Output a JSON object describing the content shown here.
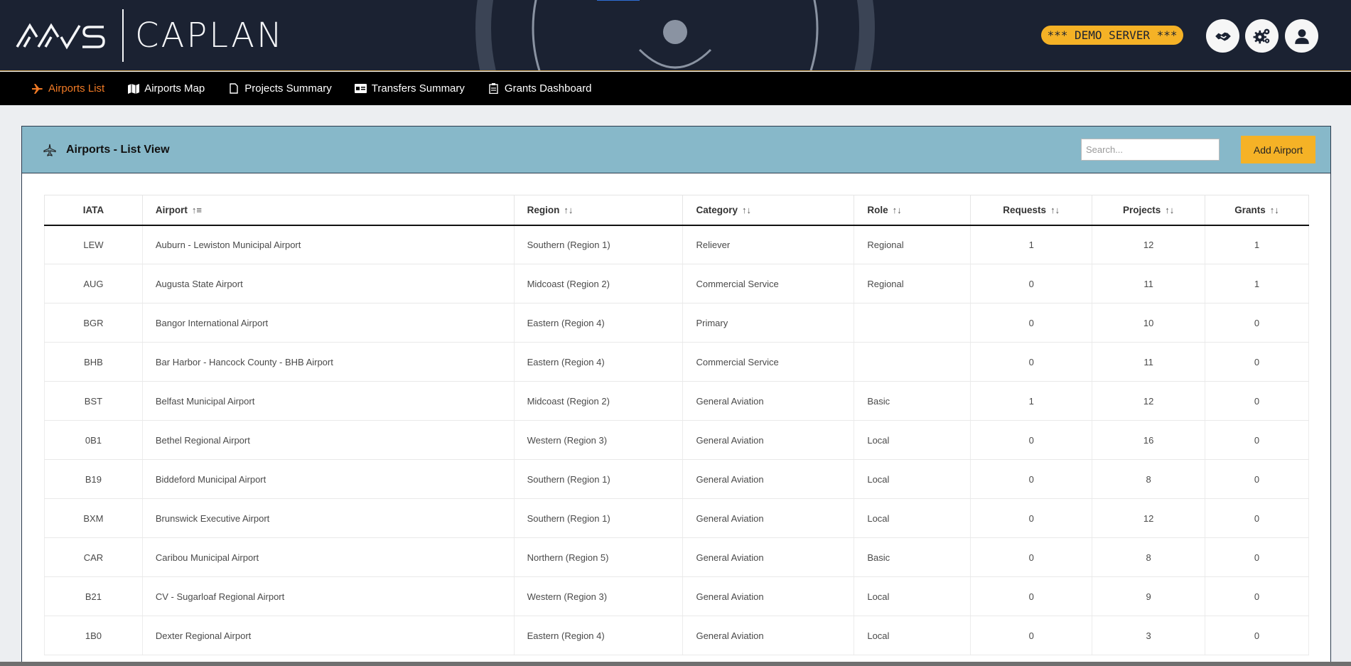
{
  "header": {
    "logo_left": "AAS",
    "logo_right": "CAPLAN",
    "demo_badge": "*** DEMO SERVER ***",
    "buttons": [
      {
        "name": "handshake-icon"
      },
      {
        "name": "gears-icon"
      },
      {
        "name": "user-icon"
      }
    ]
  },
  "nav": {
    "items": [
      {
        "label": "Airports List",
        "icon": "plane-icon",
        "active": true
      },
      {
        "label": "Airports Map",
        "icon": "map-icon",
        "active": false
      },
      {
        "label": "Projects Summary",
        "icon": "file-icon",
        "active": false
      },
      {
        "label": "Transfers Summary",
        "icon": "id-card-icon",
        "active": false
      },
      {
        "label": "Grants Dashboard",
        "icon": "clipboard-icon",
        "active": false
      }
    ]
  },
  "panel": {
    "title": "Airports - List View",
    "search_placeholder": "Search...",
    "add_button": "Add Airport"
  },
  "table": {
    "columns": [
      "IATA",
      "Airport",
      "Region",
      "Category",
      "Role",
      "Requests",
      "Projects",
      "Grants"
    ],
    "rows": [
      [
        "LEW",
        "Auburn - Lewiston Municipal Airport",
        "Southern (Region 1)",
        "Reliever",
        "Regional",
        "1",
        "12",
        "1"
      ],
      [
        "AUG",
        "Augusta State Airport",
        "Midcoast (Region 2)",
        "Commercial Service",
        "Regional",
        "0",
        "11",
        "1"
      ],
      [
        "BGR",
        "Bangor International Airport",
        "Eastern (Region 4)",
        "Primary",
        "",
        "0",
        "10",
        "0"
      ],
      [
        "BHB",
        "Bar Harbor - Hancock County - BHB Airport",
        "Eastern (Region 4)",
        "Commercial Service",
        "",
        "0",
        "11",
        "0"
      ],
      [
        "BST",
        "Belfast Municipal Airport",
        "Midcoast (Region 2)",
        "General Aviation",
        "Basic",
        "1",
        "12",
        "0"
      ],
      [
        "0B1",
        "Bethel Regional Airport",
        "Western (Region 3)",
        "General Aviation",
        "Local",
        "0",
        "16",
        "0"
      ],
      [
        "B19",
        "Biddeford Municipal Airport",
        "Southern (Region 1)",
        "General Aviation",
        "Local",
        "0",
        "8",
        "0"
      ],
      [
        "BXM",
        "Brunswick Executive Airport",
        "Southern (Region 1)",
        "General Aviation",
        "Local",
        "0",
        "12",
        "0"
      ],
      [
        "CAR",
        "Caribou Municipal Airport",
        "Northern (Region 5)",
        "General Aviation",
        "Basic",
        "0",
        "8",
        "0"
      ],
      [
        "B21",
        "CV - Sugarloaf Regional Airport",
        "Western (Region 3)",
        "General Aviation",
        "Local",
        "0",
        "9",
        "0"
      ],
      [
        "1B0",
        "Dexter Regional Airport",
        "Eastern (Region 4)",
        "General Aviation",
        "Local",
        "0",
        "3",
        "0"
      ]
    ]
  },
  "colors": {
    "header_bg": "#1b2232",
    "nav_bg": "#000000",
    "nav_active": "#f07a25",
    "panel_head_bg": "#87b8c9",
    "accent_yellow": "#f5b226"
  }
}
